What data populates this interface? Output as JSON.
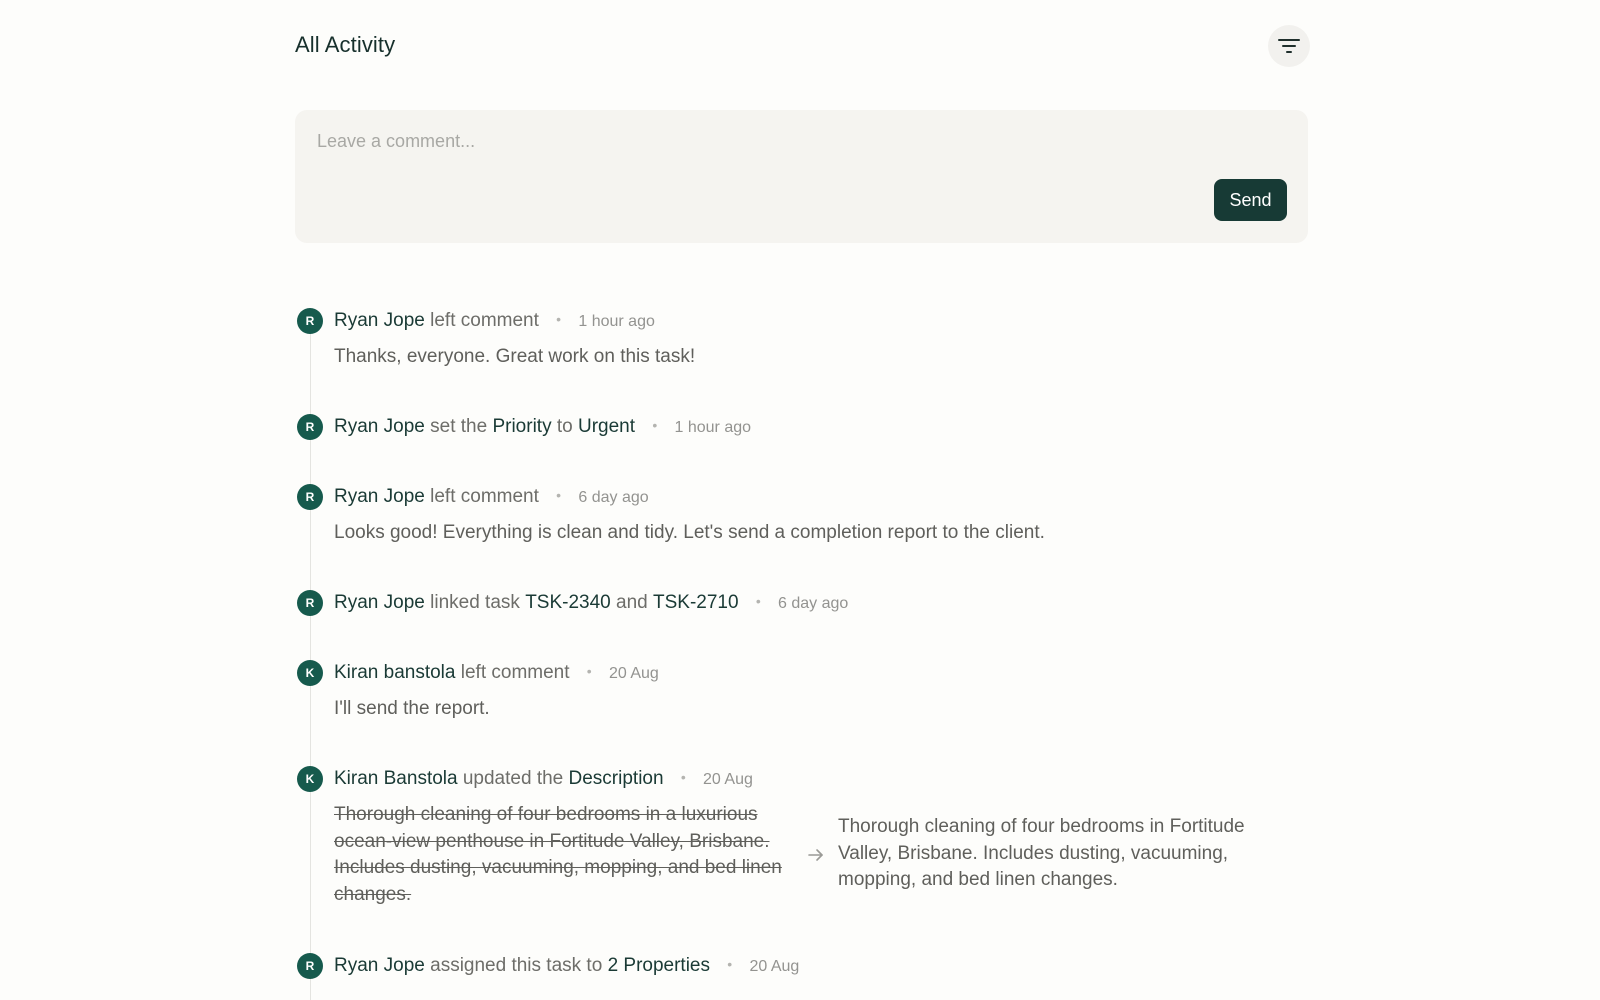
{
  "header": {
    "title": "All Activity",
    "filter_icon": "filter-lines-icon"
  },
  "comment": {
    "placeholder": "Leave a comment...",
    "send_label": "Send"
  },
  "activity": [
    {
      "avatar": "R",
      "user": "Ryan Jope",
      "text1": "left comment",
      "time": "1 hour ago",
      "body": "Thanks, everyone. Great work on this task!"
    },
    {
      "avatar": "R",
      "user": "Ryan Jope",
      "text1": "set the",
      "strong1": "Priority",
      "text2": "to",
      "strong2": "Urgent",
      "time": "1 hour ago"
    },
    {
      "avatar": "R",
      "user": "Ryan Jope",
      "text1": "left comment",
      "time": "6 day ago",
      "body": "Looks good! Everything is clean and tidy. Let's send a completion report to the client."
    },
    {
      "avatar": "R",
      "user": "Ryan Jope",
      "text1": "linked task",
      "strong1": "TSK-2340",
      "text2": "and",
      "strong2": "TSK-2710",
      "time": "6 day ago"
    },
    {
      "avatar": "K",
      "user": "Kiran banstola",
      "text1": "left comment",
      "time": "20 Aug",
      "body": "I'll send the report."
    },
    {
      "avatar": "K",
      "user": "Kiran Banstola",
      "text1": "updated the",
      "strong1": "Description",
      "time": "20 Aug",
      "old_description": "Thorough cleaning of four bedrooms in a luxurious ocean-view penthouse in Fortitude Valley, Brisbane. Includes dusting, vacuuming, mopping, and bed linen changes.",
      "new_description": "Thorough cleaning of four bedrooms in Fortitude Valley, Brisbane. Includes dusting, vacuuming, mopping, and bed linen changes."
    },
    {
      "avatar": "R",
      "user": "Ryan Jope",
      "text1": "assigned this task to",
      "strong1": "2 Properties",
      "time": "20 Aug"
    }
  ]
}
